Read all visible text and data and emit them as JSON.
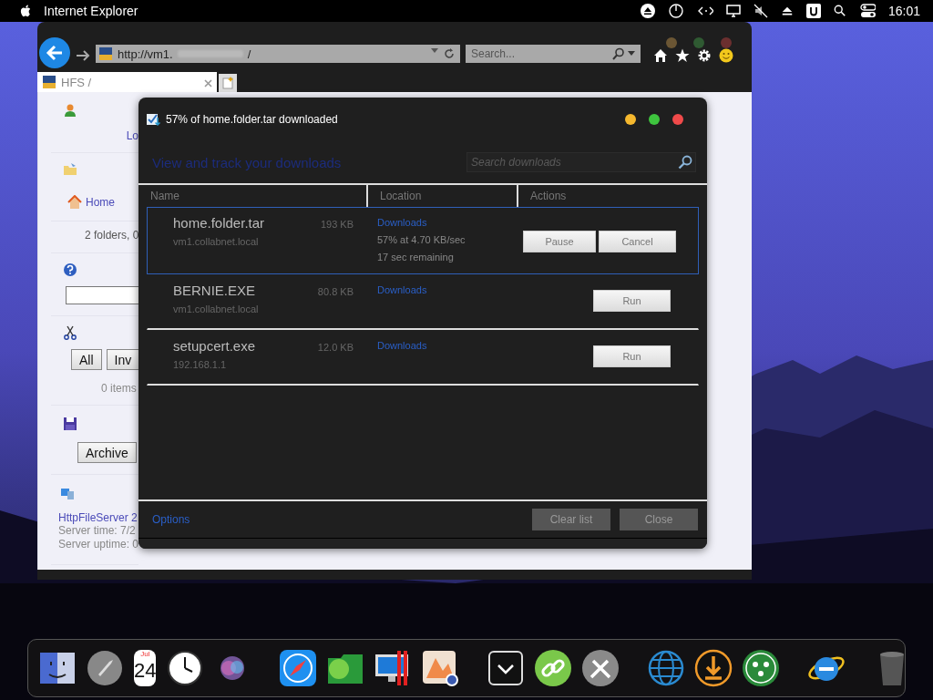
{
  "menu_bar": {
    "app_name": "Internet Explorer",
    "clock": "16:01"
  },
  "browser": {
    "address": "http://vm1.",
    "address_tail": "/",
    "search": {
      "placeholder": "Search..."
    },
    "tabs": [
      {
        "label": "HFS /",
        "selected": true
      }
    ]
  },
  "page": {
    "login_link": "Lo",
    "home_link": "Home",
    "folder_summary": "2 folders, 0",
    "select_buttons": [
      "All",
      "Inv"
    ],
    "selection_count": "0 items",
    "archive_button": "Archive",
    "server_link": "HttpFileServer 2",
    "server_time": "Server time: 7/2",
    "server_uptime": "Server uptime: 0"
  },
  "dialog": {
    "title": "57% of home.folder.tar downloaded",
    "heading": "View and track your downloads",
    "search": {
      "placeholder": "Search downloads"
    },
    "columns": [
      "Name",
      "Location",
      "Actions"
    ],
    "downloads": [
      {
        "name": "home.folder.tar",
        "size": "193 KB",
        "source": "vm1.collabnet.local",
        "location": "Downloads",
        "status": [
          "57% at 4.70 KB/sec",
          "17 sec remaining"
        ],
        "actions": [
          "Pause",
          "Cancel"
        ],
        "selected": true
      },
      {
        "name": "BERNIE.EXE",
        "size": "80.8 KB",
        "source": "vm1.collabnet.local",
        "location": "Downloads",
        "actions": [
          "Run"
        ],
        "selected": false
      },
      {
        "name": "setupcert.exe",
        "size": "12.0 KB",
        "source": "192.168.1.1",
        "location": "Downloads",
        "actions": [
          "Run"
        ],
        "selected": false
      }
    ],
    "options_link": "Options",
    "footer_buttons": [
      "Clear list",
      "Close"
    ]
  },
  "dock": {
    "calendar_month": "Jul",
    "calendar_day": "24"
  }
}
